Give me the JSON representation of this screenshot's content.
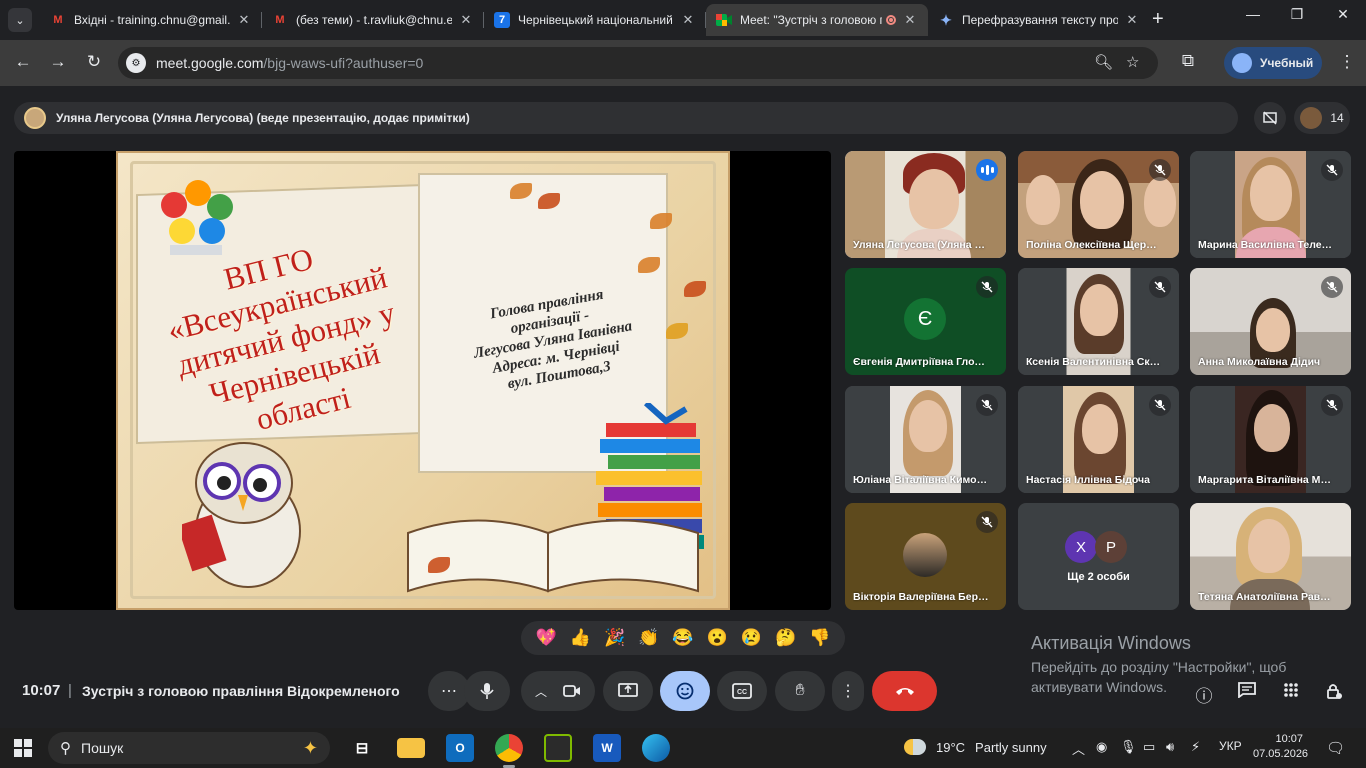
{
  "browser": {
    "tabs": [
      {
        "title": "Вхідні - training.chnu@gmail.com",
        "favicon": "gmail-icon",
        "active": false
      },
      {
        "title": "(без теми) - t.ravliuk@chnu.edu.ua",
        "favicon": "gmail-icon",
        "active": false
      },
      {
        "title": "Чернівецький національний університет",
        "favicon": "7",
        "active": false
      },
      {
        "title": "Meet: \"Зустріч з головою правління\"",
        "favicon": "meet-icon",
        "active": true
      },
      {
        "title": "Перефразування тексту про",
        "favicon": "gemini-icon",
        "active": false
      }
    ],
    "url_host": "meet.google.com",
    "url_path": "/bjg-waws-ufi?authuser=0",
    "profile_label": "Учебный"
  },
  "meet": {
    "presenter_label": "Уляна Легусова (Уляна Легусова) (веде презентацію, додає примітки)",
    "participant_count": "14",
    "slide": {
      "title_lines": [
        "ВП ГО",
        "«Всеукраїнський",
        "дитячий фонд» у",
        "Чернівецькій",
        "області"
      ],
      "info_lines": [
        "Голова правління",
        "організації  -",
        "Легусова Уляна Іванівна",
        "Адреса: м. Чернівці",
        "вул. Поштова,3"
      ]
    },
    "tiles": [
      {
        "name": "Уляна Легусова (Уляна Легусова)",
        "mic": "speaking"
      },
      {
        "name": "Поліна Олексіївна Щербанюк",
        "mic": "muted"
      },
      {
        "name": "Марина Василівна Телеуца",
        "mic": "muted"
      },
      {
        "name": "Євгенія Дмитріївна Глодан",
        "mic": "muted",
        "avatar_letter": "Є"
      },
      {
        "name": "Ксенія Валентинівна Скрипник",
        "mic": "muted"
      },
      {
        "name": "Анна Миколаївна Дідич",
        "mic": "muted"
      },
      {
        "name": "Юліана Віталіївна Кимощук",
        "mic": "muted"
      },
      {
        "name": "Настасія Іллівна Бідоча",
        "mic": "muted"
      },
      {
        "name": "Маргарита Віталіївна Мельник",
        "mic": "muted"
      },
      {
        "name": "Вікторія Валеріївна Березовська",
        "mic": "muted"
      },
      {
        "name": "Ще 2 особи",
        "mic": "none",
        "avatars": [
          "Х",
          "Р"
        ]
      },
      {
        "name": "Тетяна Анатоліївна Равлюк",
        "mic": "none"
      }
    ],
    "reactions": [
      "💖",
      "👍",
      "🎉",
      "👏",
      "😂",
      "😮",
      "😢",
      "🤔",
      "👎"
    ],
    "time": "10:07",
    "meeting_title": "Зустріч з головою правління Відокремленого підрозділу",
    "watermark_title": "Активація Windows",
    "watermark_sub": "Перейдіть до розділу \"Настройки\", щоб активувати Windows."
  },
  "taskbar": {
    "search_label": "Пошук",
    "temperature": "19°C",
    "weather": "Partly sunny",
    "language": "УКР",
    "clock_time": "10:07",
    "clock_date": "07.05.2026"
  },
  "colors": {
    "accent_blue": "#a8c7fa",
    "end_call_red": "#dc362e",
    "slide_title_red": "#c0201b"
  }
}
